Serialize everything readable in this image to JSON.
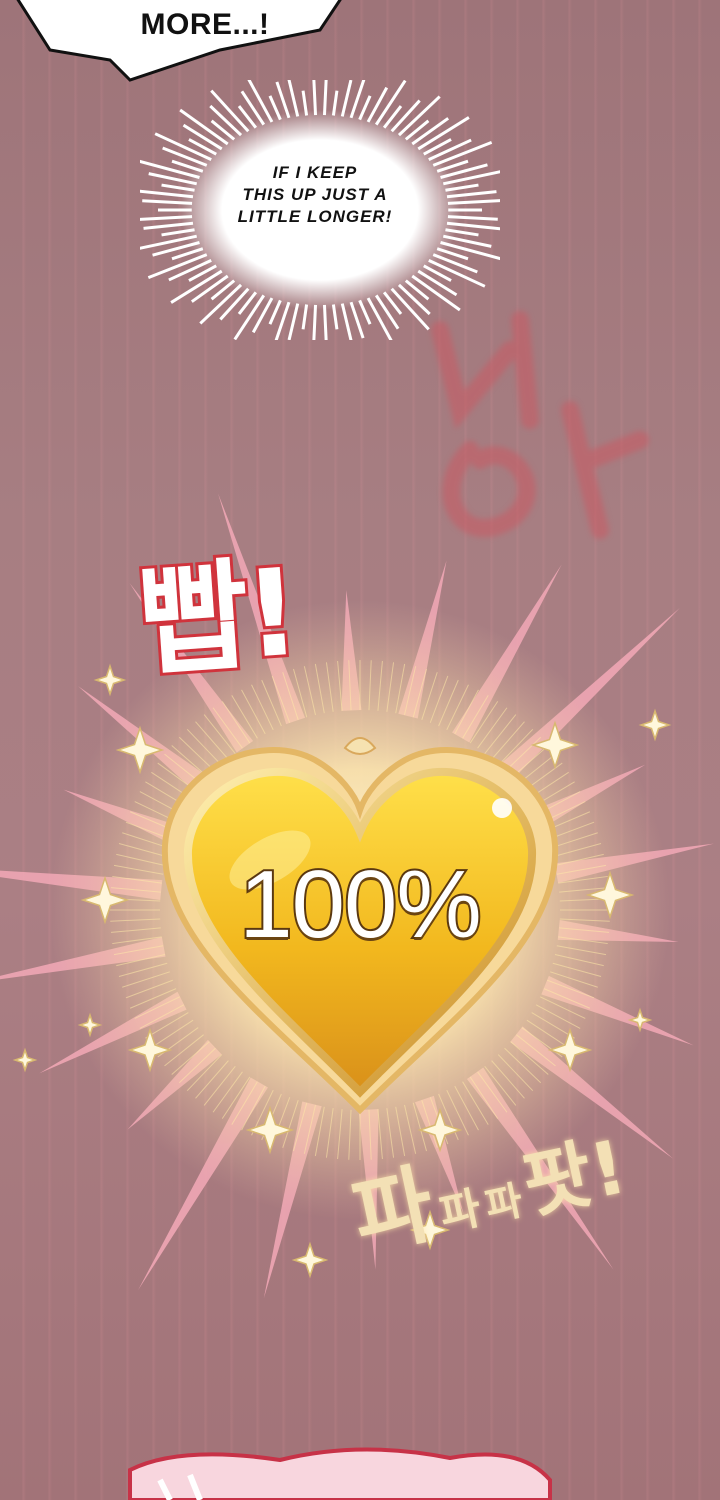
{
  "panel": {
    "speech_top_lines": [
      "MORE...!"
    ],
    "thought_burst_lines": [
      "IF I KEEP",
      "THIS UP JUST A",
      "LITTLE LONGER!"
    ],
    "sfx_bbak": "빱!",
    "heart_percent": "100%",
    "heart_fill_level": 1.0,
    "sfx_papa": [
      "파",
      "파",
      "파",
      "팟!"
    ]
  },
  "colors": {
    "background": "#a9787c",
    "heart_gold": "#f0b820",
    "glow": "#fff2c0",
    "sfx_red_stroke": "#d0333c",
    "rays_pink": "#f0a6b4"
  }
}
